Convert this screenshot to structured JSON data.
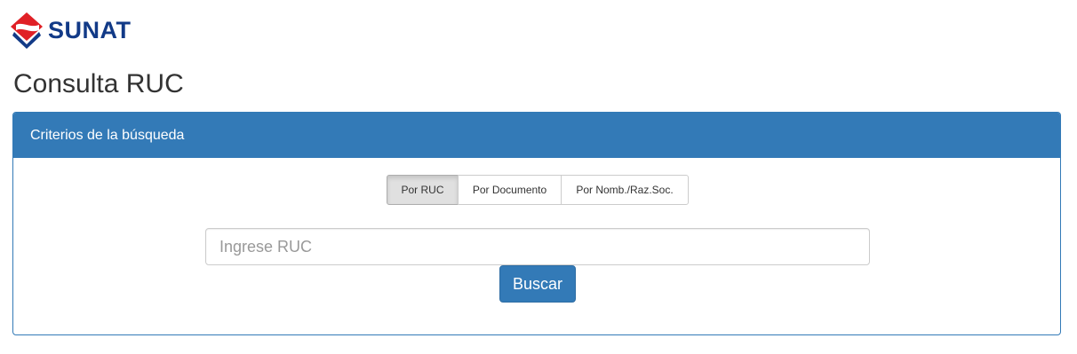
{
  "logo": {
    "text": "SUNAT",
    "colors": {
      "red": "#e02026",
      "blue": "#123a87"
    }
  },
  "page": {
    "title": "Consulta RUC"
  },
  "panel": {
    "heading": "Criterios de la búsqueda",
    "accent": "#337ab7"
  },
  "search_type": {
    "options": [
      {
        "label": "Por RUC",
        "active": true
      },
      {
        "label": "Por Documento",
        "active": false
      },
      {
        "label": "Por Nomb./Raz.Soc.",
        "active": false
      }
    ]
  },
  "search": {
    "value": "",
    "placeholder": "Ingrese RUC",
    "button_label": "Buscar"
  }
}
